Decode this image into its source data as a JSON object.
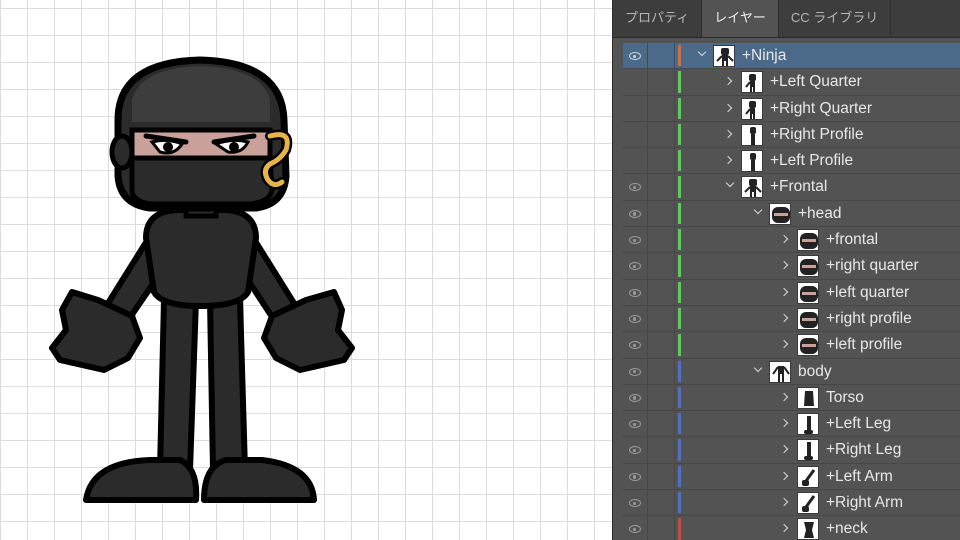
{
  "tabs": [
    {
      "label": "プロパティ",
      "active": false
    },
    {
      "label": "レイヤー",
      "active": true
    },
    {
      "label": "CC ライブラリ",
      "active": false
    }
  ],
  "colors": {
    "orange": "#e0692f",
    "green": "#4fd44d",
    "blue": "#4a6fd6",
    "red": "#d9433d"
  },
  "layers": [
    {
      "name": "+Ninja",
      "depth": 0,
      "visible": true,
      "expanded": true,
      "selected": true,
      "color": "orange",
      "thumb": "full-figure"
    },
    {
      "name": "+Left Quarter",
      "depth": 1,
      "visible": false,
      "expanded": false,
      "selected": false,
      "color": "green",
      "thumb": "quarter-figure"
    },
    {
      "name": "+Right Quarter",
      "depth": 1,
      "visible": false,
      "expanded": false,
      "selected": false,
      "color": "green",
      "thumb": "quarter-figure"
    },
    {
      "name": "+Right Profile",
      "depth": 1,
      "visible": false,
      "expanded": false,
      "selected": false,
      "color": "green",
      "thumb": "profile-figure"
    },
    {
      "name": "+Left Profile",
      "depth": 1,
      "visible": false,
      "expanded": false,
      "selected": false,
      "color": "green",
      "thumb": "profile-figure"
    },
    {
      "name": "+Frontal",
      "depth": 1,
      "visible": true,
      "expanded": true,
      "selected": false,
      "color": "green",
      "thumb": "full-figure"
    },
    {
      "name": "+head",
      "depth": 2,
      "visible": true,
      "expanded": true,
      "selected": false,
      "color": "green",
      "thumb": "head"
    },
    {
      "name": "+frontal",
      "depth": 3,
      "visible": true,
      "expanded": false,
      "selected": false,
      "color": "green",
      "thumb": "head"
    },
    {
      "name": "+right quarter",
      "depth": 3,
      "visible": true,
      "expanded": false,
      "selected": false,
      "color": "green",
      "thumb": "head"
    },
    {
      "name": "+left quarter",
      "depth": 3,
      "visible": true,
      "expanded": false,
      "selected": false,
      "color": "green",
      "thumb": "head"
    },
    {
      "name": "+right profile",
      "depth": 3,
      "visible": true,
      "expanded": false,
      "selected": false,
      "color": "green",
      "thumb": "head"
    },
    {
      "name": "+left profile",
      "depth": 3,
      "visible": true,
      "expanded": false,
      "selected": false,
      "color": "green",
      "thumb": "head"
    },
    {
      "name": "body",
      "depth": 2,
      "visible": true,
      "expanded": true,
      "selected": false,
      "color": "blue",
      "thumb": "body"
    },
    {
      "name": "Torso",
      "depth": 3,
      "visible": true,
      "expanded": false,
      "selected": false,
      "color": "blue",
      "thumb": "torso"
    },
    {
      "name": "+Left Leg",
      "depth": 3,
      "visible": true,
      "expanded": false,
      "selected": false,
      "color": "blue",
      "thumb": "leg"
    },
    {
      "name": "+Right Leg",
      "depth": 3,
      "visible": true,
      "expanded": false,
      "selected": false,
      "color": "blue",
      "thumb": "leg"
    },
    {
      "name": "+Left Arm",
      "depth": 3,
      "visible": true,
      "expanded": false,
      "selected": false,
      "color": "blue",
      "thumb": "arm"
    },
    {
      "name": "+Right Arm",
      "depth": 3,
      "visible": true,
      "expanded": false,
      "selected": false,
      "color": "blue",
      "thumb": "arm"
    },
    {
      "name": "+neck",
      "depth": 3,
      "visible": true,
      "expanded": false,
      "selected": false,
      "color": "red",
      "thumb": "neck"
    }
  ]
}
